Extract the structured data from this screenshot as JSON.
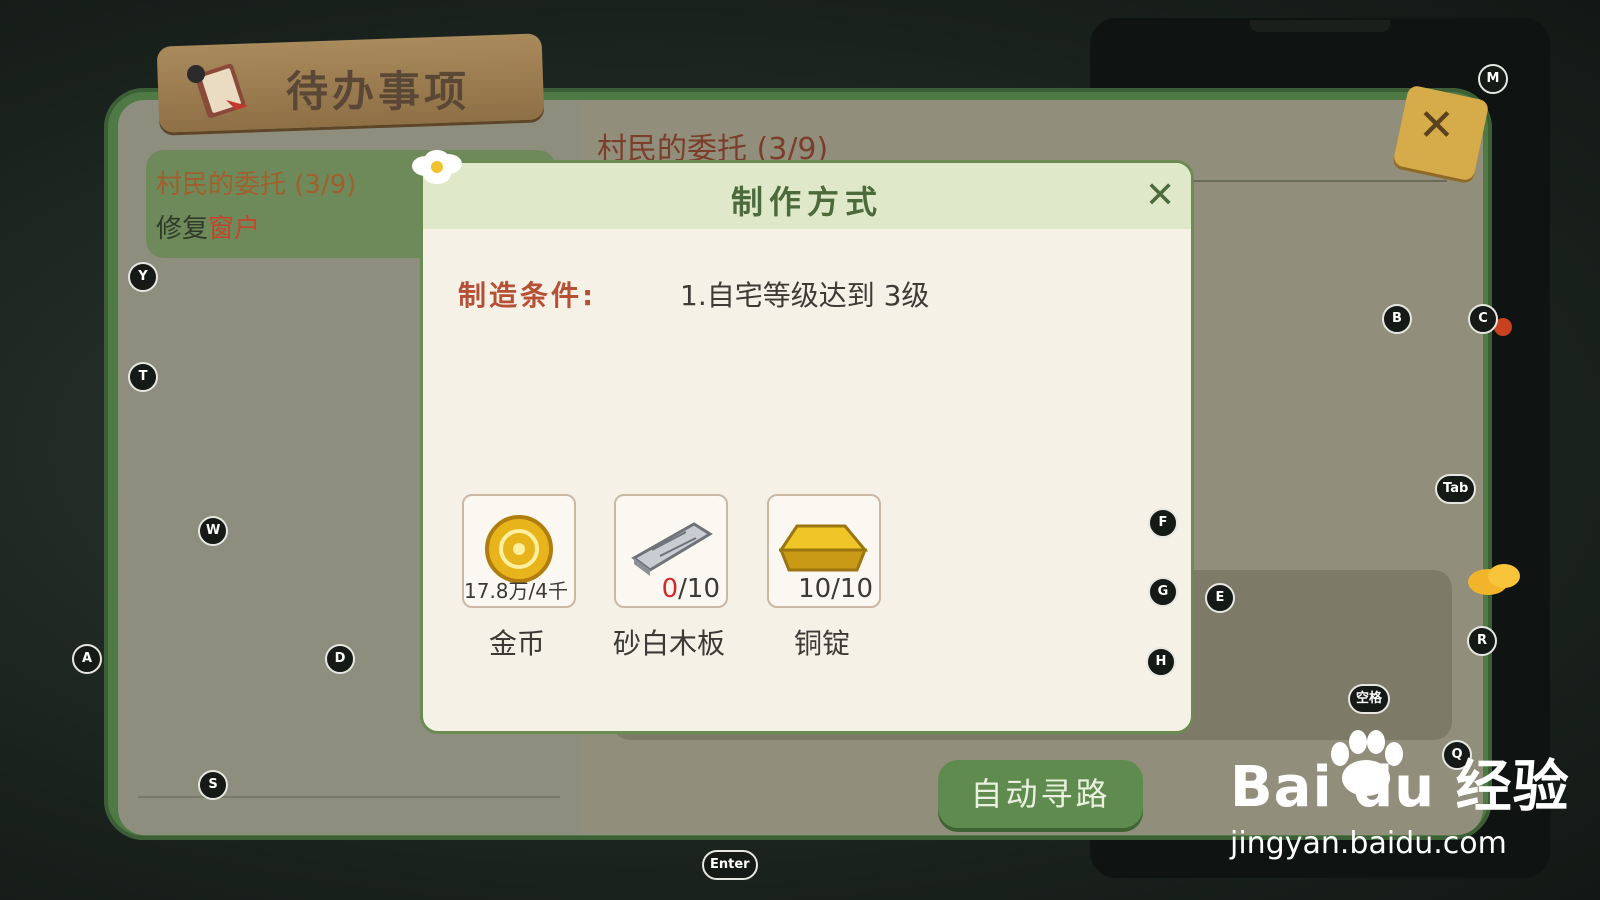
{
  "sign": {
    "title": "待办事项"
  },
  "quest": {
    "title": "村民的委托 (3/9)",
    "sub_prefix": "修复",
    "sub_highlight": "窗户"
  },
  "right_page": {
    "title": "村民的委托 (3/9)"
  },
  "dialog": {
    "title": "制作方式",
    "condition_label": "制造条件:",
    "condition_value": "1.自宅等级达到 3级",
    "materials": [
      {
        "name": "金币",
        "count": "17.8万/4千",
        "icon": "gold-coin-icon"
      },
      {
        "name": "砂白木板",
        "have": "0",
        "need": "/10",
        "icon": "wood-plank-icon"
      },
      {
        "name": "铜锭",
        "count": "10/10",
        "icon": "copper-ingot-icon"
      }
    ]
  },
  "auto_path_button": "自动寻路",
  "keys": {
    "m": "M",
    "y": "Y",
    "t": "T",
    "w": "W",
    "a": "A",
    "d": "D",
    "s": "S",
    "b": "B",
    "c": "C",
    "tab": "Tab",
    "f": "F",
    "g": "G",
    "h": "H",
    "e": "E",
    "r": "R",
    "space": "空格",
    "q": "Q",
    "enter": "Enter"
  },
  "watermark": {
    "main": "Bai du 经验",
    "sub": "jingyan.baidu.com"
  },
  "colors": {
    "board_green": "#4f7a45",
    "dialog_bg": "#f5f1e7",
    "accent_red": "#b65035",
    "button_green": "#5f8c4e"
  }
}
